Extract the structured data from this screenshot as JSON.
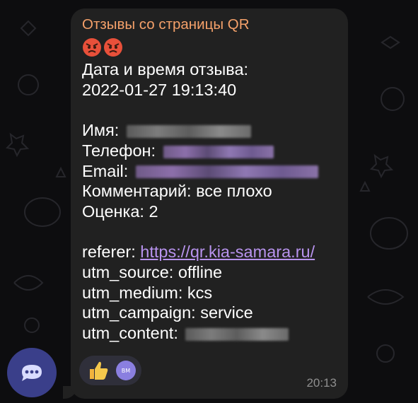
{
  "message": {
    "sender_name": "Отзывы со страницы QR",
    "emojis": [
      "angry-face",
      "angry-face"
    ],
    "datetime_label": "Дата и время отзыва:",
    "datetime_value": "2022-01-27 19:13:40",
    "name_label": "Имя:",
    "phone_label": "Телефон:",
    "email_label": "Email:",
    "comment_line": "Комментарий: все плохо",
    "rating_line": "Оценка: 2",
    "referer_label": "referer: ",
    "referer_link": "https://qr.kia-samara.ru/",
    "utm_source_line": "utm_source: offline",
    "utm_medium_line": "utm_medium: kcs",
    "utm_campaign_line": "utm_campaign: service",
    "utm_content_label": "utm_content:",
    "time": "20:13"
  },
  "reactions": {
    "emoji": "thumbs-up",
    "avatar_initials": "BM"
  },
  "colors": {
    "background": "#0d0d0f",
    "bubble": "#212121",
    "sender": "#f5a16a",
    "link": "#b893ee",
    "avatar": "#3a3f8a",
    "reaction_avatar": "#8a7fe0"
  }
}
